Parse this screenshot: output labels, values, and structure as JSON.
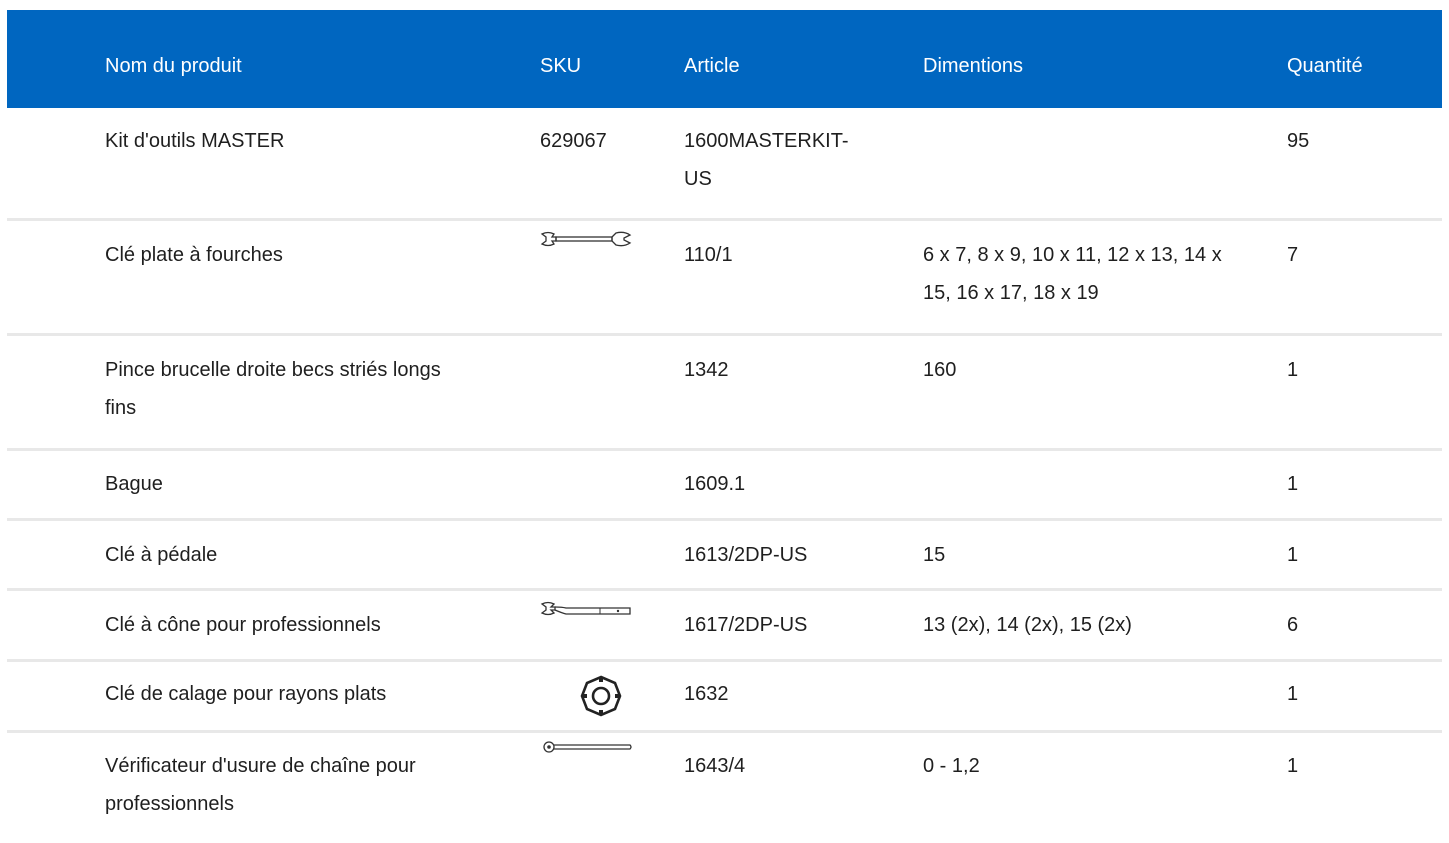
{
  "table": {
    "headers": {
      "name": "Nom du produit",
      "sku": "SKU",
      "article": "Article",
      "dimensions": "Dimentions",
      "quantity": "Quantité"
    },
    "rows": [
      {
        "name": "Kit d'outils MASTER",
        "sku": "629067",
        "article": "1600MASTERKIT-US",
        "dimensions": "",
        "quantity": "95",
        "icon": ""
      },
      {
        "name": "Clé plate à fourches",
        "sku": "",
        "article": "110/1",
        "dimensions": "6 x 7, 8 x 9, 10 x 11, 12 x 13, 14 x 15, 16 x 17, 18 x 19",
        "quantity": "7",
        "icon": "open-end-wrench-icon"
      },
      {
        "name": "Pince brucelle droite becs striés longs fins",
        "sku": "",
        "article": "1342",
        "dimensions": "160",
        "quantity": "1",
        "icon": ""
      },
      {
        "name": "Bague",
        "sku": "",
        "article": "1609.1",
        "dimensions": "",
        "quantity": "1",
        "icon": ""
      },
      {
        "name": "Clé à pédale",
        "sku": "",
        "article": "1613/2DP-US",
        "dimensions": "15",
        "quantity": "1",
        "icon": ""
      },
      {
        "name": "Clé à cône pour professionnels",
        "sku": "",
        "article": "1617/2DP-US",
        "dimensions": "13 (2x), 14 (2x), 15 (2x)",
        "quantity": "6",
        "icon": "cone-wrench-icon"
      },
      {
        "name": "Clé de calage pour rayons plats",
        "sku": "",
        "article": "1632",
        "dimensions": "",
        "quantity": "1",
        "icon": "spoke-wrench-icon"
      },
      {
        "name": "Vérificateur d'usure de chaîne pour professionnels",
        "sku": "",
        "article": "1643/4",
        "dimensions": "0 - 1,2",
        "quantity": "1",
        "icon": "chain-checker-icon"
      }
    ]
  },
  "colors": {
    "header_bg": "#0066c0",
    "row_divider": "#e8e8e8"
  }
}
